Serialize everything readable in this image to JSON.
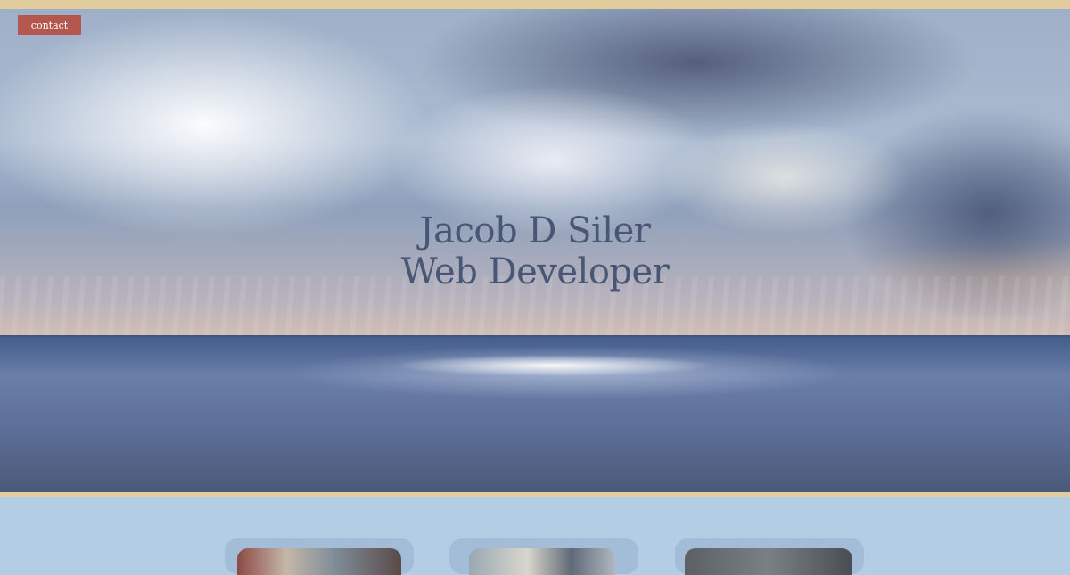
{
  "nav": {
    "contact_label": "contact"
  },
  "hero": {
    "title_line1": "Jacob D Siler",
    "title_line2": "Web Developer",
    "image": "ocean-sky-with-sunrays"
  },
  "colors": {
    "accent_border": "#e0cc9c",
    "contact_button": "#b4574e",
    "title_text": "#485775",
    "page_background": "#b3cde4",
    "card_background": "#a3bdd8"
  },
  "projects": {
    "cards": [
      {
        "thumbnail": "project-photo-1"
      },
      {
        "thumbnail": "project-photo-2"
      },
      {
        "thumbnail": "project-photo-3"
      }
    ]
  }
}
